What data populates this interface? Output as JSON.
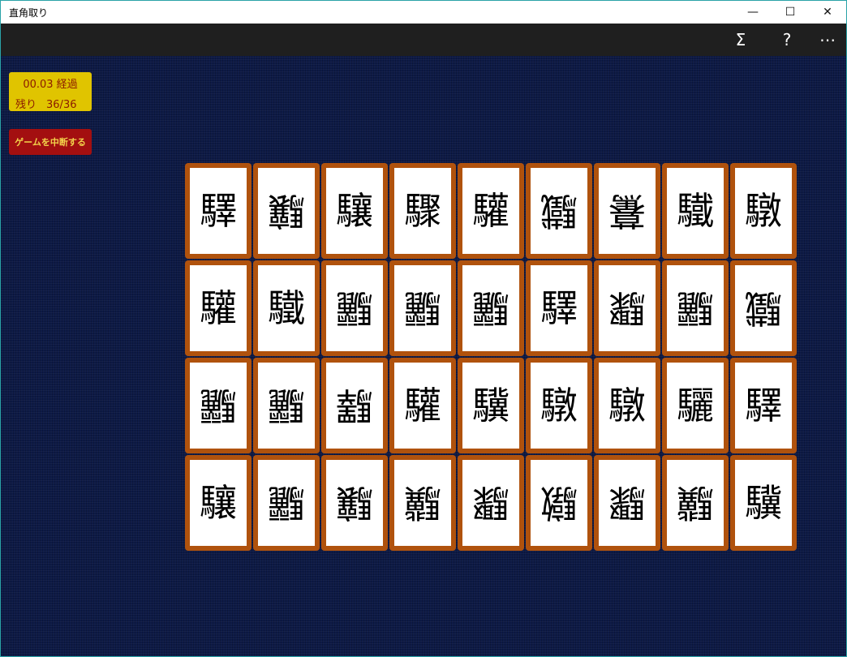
{
  "window": {
    "title": "直角取り",
    "minimize_glyph": "—",
    "maximize_glyph": "☐",
    "close_glyph": "✕"
  },
  "commandbar": {
    "stats_glyph": "Σ",
    "help_glyph": "?",
    "more_glyph": "⋯"
  },
  "status": {
    "elapsed": "00.03 経過",
    "remaining_label": "残り",
    "remaining_value": "36/36"
  },
  "abort_label": "ゲームを中断する",
  "cards": [
    [
      {
        "char": "驛",
        "orientation": "normal"
      },
      {
        "char": "驤",
        "orientation": "rotated"
      },
      {
        "char": "驤",
        "orientation": "normal"
      },
      {
        "char": "驟",
        "orientation": "normal"
      },
      {
        "char": "驩",
        "orientation": "normal"
      },
      {
        "char": "驖",
        "orientation": "rotated"
      },
      {
        "char": "驀",
        "orientation": "rotated"
      },
      {
        "char": "驖",
        "orientation": "normal"
      },
      {
        "char": "驐",
        "orientation": "normal"
      }
    ],
    [
      {
        "char": "驩",
        "orientation": "normal"
      },
      {
        "char": "驖",
        "orientation": "normal"
      },
      {
        "char": "驪",
        "orientation": "rotated"
      },
      {
        "char": "驪",
        "orientation": "rotated"
      },
      {
        "char": "驪",
        "orientation": "rotated"
      },
      {
        "char": "驛",
        "orientation": "normal"
      },
      {
        "char": "驟",
        "orientation": "rotated"
      },
      {
        "char": "驪",
        "orientation": "rotated"
      },
      {
        "char": "驖",
        "orientation": "rotated"
      }
    ],
    [
      {
        "char": "驪",
        "orientation": "rotated"
      },
      {
        "char": "驪",
        "orientation": "rotated"
      },
      {
        "char": "驛",
        "orientation": "rotated"
      },
      {
        "char": "驩",
        "orientation": "normal"
      },
      {
        "char": "驥",
        "orientation": "normal"
      },
      {
        "char": "驐",
        "orientation": "normal"
      },
      {
        "char": "驐",
        "orientation": "normal"
      },
      {
        "char": "驪",
        "orientation": "normal"
      },
      {
        "char": "驛",
        "orientation": "normal"
      }
    ],
    [
      {
        "char": "驤",
        "orientation": "normal"
      },
      {
        "char": "驪",
        "orientation": "rotated"
      },
      {
        "char": "驤",
        "orientation": "rotated"
      },
      {
        "char": "驥",
        "orientation": "rotated"
      },
      {
        "char": "驟",
        "orientation": "rotated"
      },
      {
        "char": "驐",
        "orientation": "rotated"
      },
      {
        "char": "驟",
        "orientation": "rotated"
      },
      {
        "char": "驥",
        "orientation": "rotated"
      },
      {
        "char": "驥",
        "orientation": "normal"
      }
    ]
  ]
}
